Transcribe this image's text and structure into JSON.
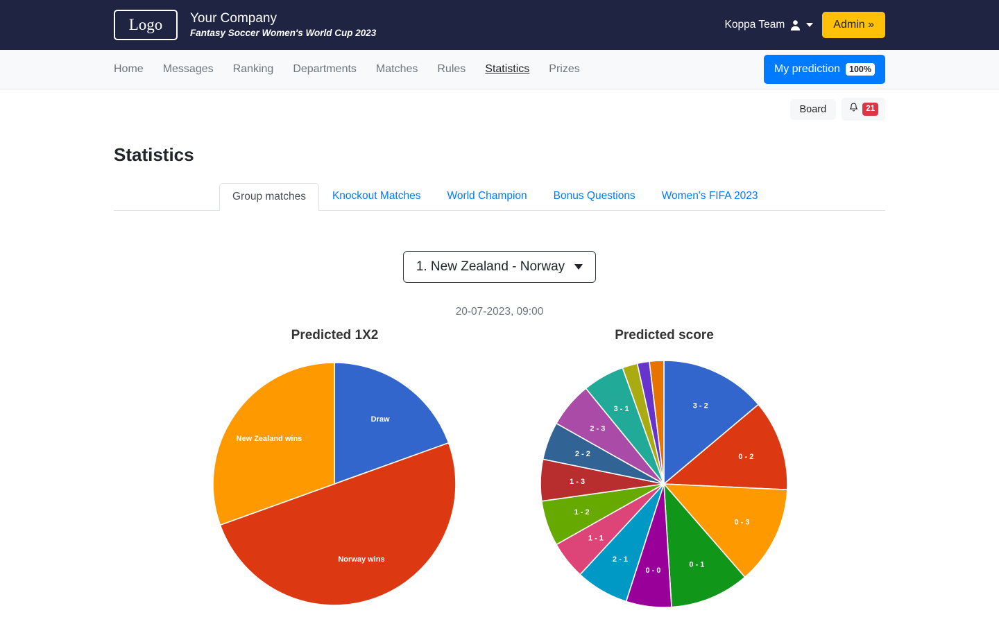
{
  "header": {
    "logo_text": "Logo",
    "company_name": "Your Company",
    "company_subtitle": "Fantasy Soccer Women's World Cup 2023",
    "user_name": "Koppa Team",
    "admin_label": "Admin »"
  },
  "nav": {
    "links": [
      {
        "label": "Home",
        "active": false
      },
      {
        "label": "Messages",
        "active": false
      },
      {
        "label": "Ranking",
        "active": false
      },
      {
        "label": "Departments",
        "active": false
      },
      {
        "label": "Matches",
        "active": false
      },
      {
        "label": "Rules",
        "active": false
      },
      {
        "label": "Statistics",
        "active": true
      },
      {
        "label": "Prizes",
        "active": false
      }
    ],
    "prediction_label": "My prediction",
    "prediction_badge": "100%"
  },
  "subbar": {
    "board_label": "Board",
    "notification_count": "21"
  },
  "page": {
    "title": "Statistics"
  },
  "tabs": [
    {
      "label": "Group matches",
      "active": true
    },
    {
      "label": "Knockout Matches",
      "active": false
    },
    {
      "label": "World Champion",
      "active": false
    },
    {
      "label": "Bonus Questions",
      "active": false
    },
    {
      "label": "Women's FIFA 2023",
      "active": false
    }
  ],
  "match_selector": {
    "selected": "1. New Zealand - Norway"
  },
  "match_date": "20-07-2023, 09:00",
  "chart_data": [
    {
      "type": "pie",
      "title": "Predicted 1X2",
      "labels": [
        "Draw",
        "Norway wins",
        "New Zealand wins"
      ],
      "values": [
        19.5,
        50.0,
        30.5
      ],
      "colors": [
        "#3366cc",
        "#dc3912",
        "#ff9900"
      ],
      "start_angle": 0,
      "legend": "none",
      "label_position": "inside"
    },
    {
      "type": "pie",
      "title": "Predicted score",
      "labels": [
        "3 - 2",
        "0 - 2",
        "0 - 3",
        "0 - 1",
        "0 - 0",
        "2 - 1",
        "1 - 1",
        "1 - 2",
        "1 - 3",
        "2 - 2",
        "2 - 3",
        "3 - 1",
        "",
        "",
        ""
      ],
      "values": [
        14.0,
        12.0,
        13.0,
        10.5,
        6.0,
        7.0,
        5.0,
        6.0,
        5.5,
        5.0,
        6.0,
        5.5,
        2.0,
        1.6,
        1.9
      ],
      "colors": [
        "#3366cc",
        "#dc3912",
        "#ff9900",
        "#109618",
        "#990099",
        "#0099c6",
        "#dd4477",
        "#66aa00",
        "#b82e2e",
        "#316395",
        "#a94ba7",
        "#22aa99",
        "#aaaa11",
        "#6633cc",
        "#e67300"
      ],
      "start_angle": 0,
      "legend": "none",
      "label_position": "inside"
    }
  ]
}
